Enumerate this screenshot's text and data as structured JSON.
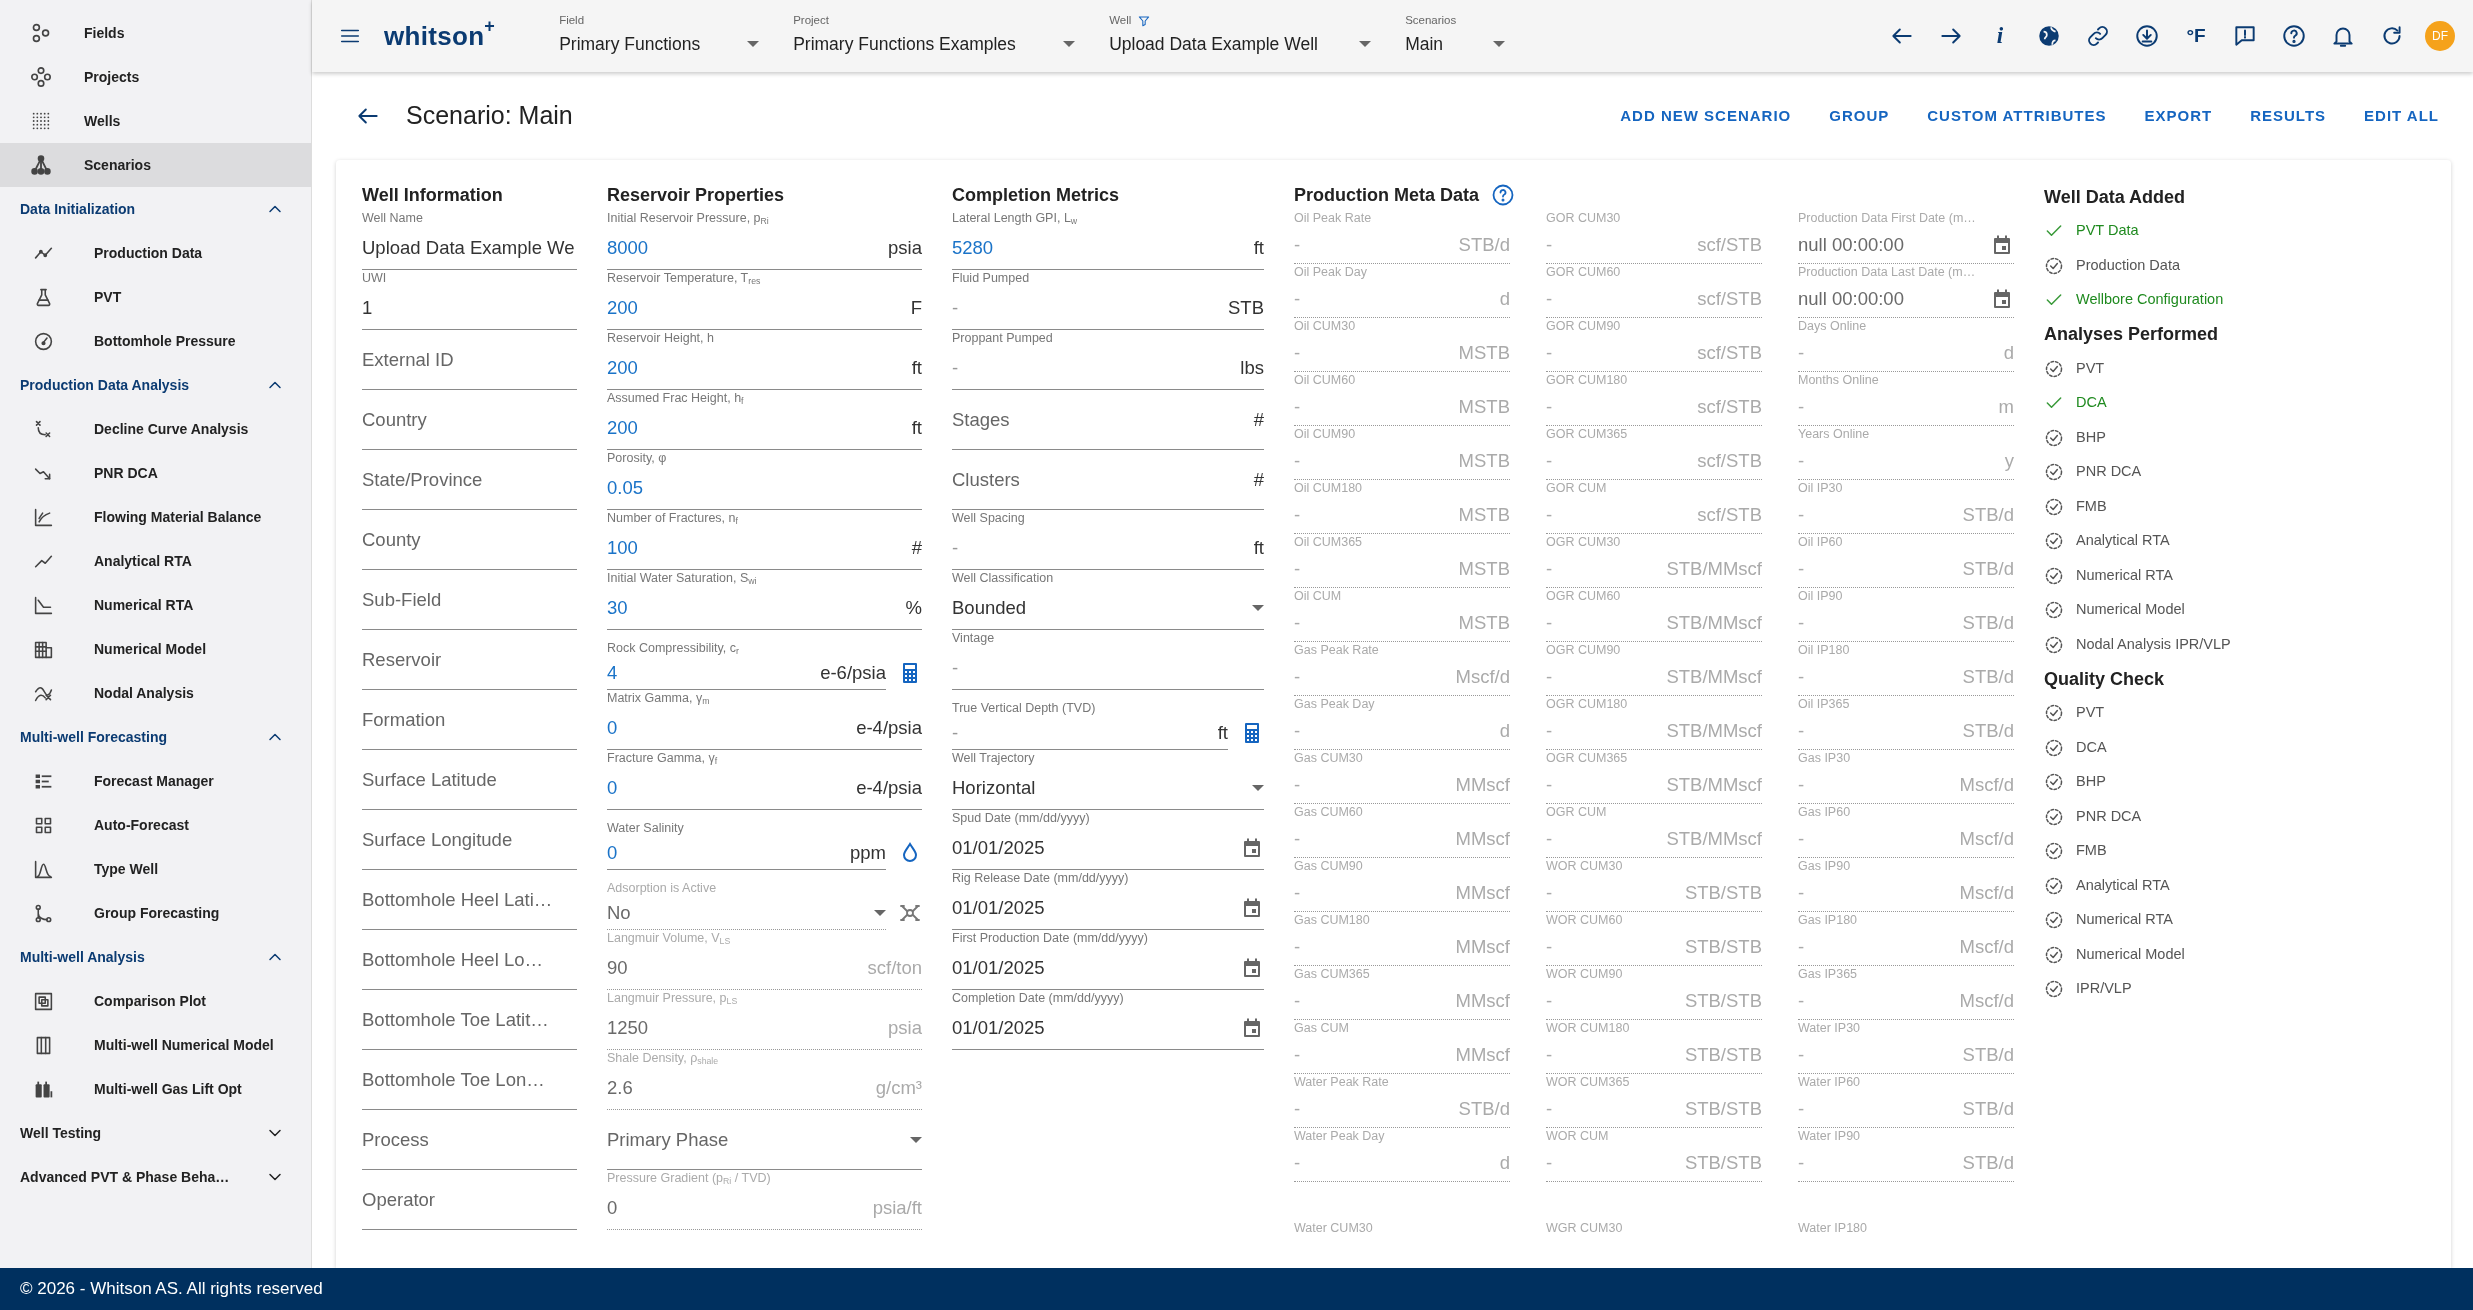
{
  "sidebar": {
    "items": [
      {
        "label": "Fields",
        "selected": false
      },
      {
        "label": "Projects",
        "selected": false
      },
      {
        "label": "Wells",
        "selected": false
      },
      {
        "label": "Scenarios",
        "selected": true
      }
    ],
    "sections": [
      {
        "title": "Data Initialization",
        "expanded": true,
        "items": [
          {
            "label": "Production Data",
            "selected": false
          },
          {
            "label": "PVT",
            "selected": false
          },
          {
            "label": "Bottomhole Pressure",
            "selected": false
          }
        ]
      },
      {
        "title": "Production Data Analysis",
        "expanded": true,
        "items": [
          {
            "label": "Decline Curve Analysis",
            "selected": false
          },
          {
            "label": "PNR DCA",
            "selected": false
          },
          {
            "label": "Flowing Material Balance",
            "selected": false
          },
          {
            "label": "Analytical RTA",
            "selected": false
          },
          {
            "label": "Numerical RTA",
            "selected": false
          },
          {
            "label": "Numerical Model",
            "selected": false
          },
          {
            "label": "Nodal Analysis",
            "selected": false
          }
        ]
      },
      {
        "title": "Multi-well Forecasting",
        "expanded": true,
        "items": [
          {
            "label": "Forecast Manager",
            "selected": false
          },
          {
            "label": "Auto-Forecast",
            "selected": false
          },
          {
            "label": "Type Well",
            "selected": false
          },
          {
            "label": "Group Forecasting",
            "selected": false
          }
        ]
      },
      {
        "title": "Multi-well Analysis",
        "expanded": true,
        "items": [
          {
            "label": "Comparison Plot",
            "selected": false
          },
          {
            "label": "Multi-well Numerical Model",
            "selected": false
          },
          {
            "label": "Multi-well Gas Lift Opt",
            "selected": false
          }
        ]
      },
      {
        "title": "Well Testing",
        "expanded": false
      },
      {
        "title": "Advanced PVT & Phase Beha…",
        "expanded": false
      }
    ]
  },
  "app_bar": {
    "logo": "whitson$^{+}$",
    "selectors": [
      {
        "label": "Field",
        "value": "Primary Functions"
      },
      {
        "label": "Project",
        "value": "Primary Functions Examples"
      },
      {
        "label": "Well",
        "value": "Upload Data Example Well"
      },
      {
        "label": "Scenarios",
        "value": "Main"
      }
    ],
    "info_glyph": "i",
    "units": "°F",
    "avatar": "DF"
  },
  "page": {
    "title": "Scenario: Main",
    "actions": [
      "ADD NEW SCENARIO",
      "GROUP",
      "CUSTOM ATTRIBUTES",
      "EXPORT",
      "RESULTS",
      "EDIT ALL"
    ]
  },
  "well_information": {
    "title": "Well Information",
    "fields": [
      {
        "label": "Well Name",
        "value": "Upload Data Example We",
        "kind": "text",
        "disabled": false
      },
      {
        "label": "UWI",
        "value": "1",
        "kind": "text",
        "disabled": false
      },
      {
        "placeholder": "External ID",
        "kind": "text",
        "disabled": false
      },
      {
        "placeholder": "Country",
        "kind": "text",
        "disabled": false
      },
      {
        "placeholder": "State/Province",
        "kind": "text",
        "disabled": false
      },
      {
        "placeholder": "County",
        "kind": "text",
        "disabled": false
      },
      {
        "placeholder": "Sub-Field",
        "kind": "text",
        "disabled": false
      },
      {
        "placeholder": "Reservoir",
        "kind": "text",
        "disabled": false
      },
      {
        "placeholder": "Formation",
        "kind": "text",
        "disabled": false
      },
      {
        "placeholder": "Surface Latitude",
        "kind": "text",
        "disabled": false
      },
      {
        "placeholder": "Surface Longitude",
        "kind": "text",
        "disabled": false
      },
      {
        "placeholder": "Bottomhole Heel Lati…",
        "kind": "text",
        "disabled": false
      },
      {
        "placeholder": "Bottomhole Heel Lo…",
        "kind": "text",
        "disabled": false
      },
      {
        "placeholder": "Bottomhole Toe Latit…",
        "kind": "text",
        "disabled": false
      },
      {
        "placeholder": "Bottomhole Toe Lon…",
        "kind": "text",
        "disabled": false
      },
      {
        "placeholder": "Process",
        "kind": "text",
        "disabled": false
      },
      {
        "placeholder": "Operator",
        "kind": "text",
        "disabled": false
      }
    ]
  },
  "reservoir_properties": {
    "title": "Reservoir Properties",
    "fields": [
      {
        "label": "Initial Reservoir Pressure, p$_{Ri}$",
        "value": "8000",
        "unit": "psia",
        "kind": "number",
        "disabled": false
      },
      {
        "label": "Reservoir Temperature, T$_{res}$",
        "value": "200",
        "unit": "F",
        "kind": "number",
        "disabled": false
      },
      {
        "label": "Reservoir Height, h",
        "value": "200",
        "unit": "ft",
        "kind": "number",
        "disabled": false
      },
      {
        "label": "Assumed Frac Height, h$_{f}$",
        "value": "200",
        "unit": "ft",
        "kind": "number",
        "disabled": false
      },
      {
        "label": "Porosity, φ",
        "value": "0.05",
        "kind": "number",
        "disabled": false
      },
      {
        "label": "Number of Fractures, n$_{f}$",
        "value": "100",
        "unit": "#",
        "kind": "number",
        "disabled": false
      },
      {
        "label": "Initial Water Saturation, S$_{wi}$",
        "value": "30",
        "unit": "%",
        "kind": "number",
        "disabled": false
      },
      {
        "label": "Rock Compressibility, c$_{r}$",
        "value": "4",
        "unit": "e-6/psia",
        "kind": "number",
        "disabled": false,
        "side_button": {
          "kind": "calculator"
        }
      },
      {
        "label": "Matrix Gamma, γ$_{m}$",
        "value": "0",
        "unit": "e-4/psia",
        "kind": "number",
        "disabled": false
      },
      {
        "label": "Fracture Gamma, γ$_{f}$",
        "value": "0",
        "unit": "e-4/psia",
        "kind": "number",
        "disabled": false
      },
      {
        "label": "Water Salinity",
        "value": "0",
        "unit": "ppm",
        "kind": "number",
        "disabled": false,
        "side_button": {
          "kind": "salinity"
        }
      },
      {
        "label": "Adsorption is Active",
        "value": "No",
        "kind": "select",
        "disabled": true,
        "side_button": {
          "kind": "adsorption"
        }
      },
      {
        "label": "Langmuir Volume, V$_{LS}$",
        "value": "90",
        "unit": "scf/ton",
        "kind": "text",
        "disabled": true
      },
      {
        "label": "Langmuir Pressure, p$_{LS}$",
        "value": "1250",
        "unit": "psia",
        "kind": "text",
        "disabled": true
      },
      {
        "label": "Shale Density, ρ$_{shale}$",
        "value": "2.6",
        "unit": "g/cm³",
        "kind": "text",
        "disabled": true
      },
      {
        "placeholder": "Primary Phase",
        "kind": "select",
        "disabled": false
      },
      {
        "label": "Pressure Gradient (p$_{Ri}$ / TVD)",
        "value": "0",
        "unit": "psia/ft",
        "kind": "text",
        "disabled": true
      }
    ]
  },
  "completion_metrics": {
    "title": "Completion Metrics",
    "fields": [
      {
        "label": "Lateral Length GPI, L$_{w}$",
        "value": "5280",
        "unit": "ft",
        "kind": "number",
        "disabled": false
      },
      {
        "label": "Fluid Pumped",
        "value": "-",
        "unit": "STB",
        "kind": "empty",
        "disabled": false
      },
      {
        "label": "Proppant Pumped",
        "value": "-",
        "unit": "lbs",
        "kind": "empty",
        "disabled": false
      },
      {
        "placeholder": "Stages",
        "unit": "#",
        "kind": "text",
        "disabled": false
      },
      {
        "placeholder": "Clusters",
        "unit": "#",
        "kind": "text",
        "disabled": false
      },
      {
        "label": "Well Spacing",
        "value": "-",
        "unit": "ft",
        "kind": "empty",
        "disabled": false
      },
      {
        "label": "Well Classification",
        "value": "Bounded",
        "kind": "select",
        "disabled": false
      },
      {
        "label": "Vintage",
        "value": "-",
        "kind": "empty",
        "disabled": false
      },
      {
        "label": "True Vertical Depth (TVD)",
        "value": "-",
        "unit": "ft",
        "kind": "empty",
        "disabled": false,
        "side_button": {
          "kind": "calculator"
        }
      },
      {
        "label": "Well Trajectory",
        "value": "Horizontal",
        "kind": "select",
        "disabled": false
      },
      {
        "label": "Spud Date (mm/dd/yyyy)",
        "value": "01/01/2025",
        "kind": "date",
        "disabled": false
      },
      {
        "label": "Rig Release Date (mm/dd/yyyy)",
        "value": "01/01/2025",
        "kind": "date",
        "disabled": false
      },
      {
        "label": "First Production Date (mm/dd/yyyy)",
        "value": "01/01/2025",
        "kind": "date",
        "disabled": false
      },
      {
        "label": "Completion Date (mm/dd/yyyy)",
        "value": "01/01/2025",
        "kind": "date",
        "disabled": false
      }
    ]
  },
  "production_meta_data": {
    "title": "Production Meta Data",
    "columns": [
      [
        {
          "label": "Oil Peak Rate",
          "value": "-",
          "unit": "STB/d",
          "kind": "empty",
          "disabled": true
        },
        {
          "label": "Oil Peak Day",
          "value": "-",
          "unit": "d",
          "kind": "empty",
          "disabled": true
        },
        {
          "label": "Oil CUM30",
          "value": "-",
          "unit": "MSTB",
          "kind": "empty",
          "disabled": true
        },
        {
          "label": "Oil CUM60",
          "value": "-",
          "unit": "MSTB",
          "kind": "empty",
          "disabled": true
        },
        {
          "label": "Oil CUM90",
          "value": "-",
          "unit": "MSTB",
          "kind": "empty",
          "disabled": true
        },
        {
          "label": "Oil CUM180",
          "value": "-",
          "unit": "MSTB",
          "kind": "empty",
          "disabled": true
        },
        {
          "label": "Oil CUM365",
          "value": "-",
          "unit": "MSTB",
          "kind": "empty",
          "disabled": true
        },
        {
          "label": "Oil CUM",
          "value": "-",
          "unit": "MSTB",
          "kind": "empty",
          "disabled": true
        },
        {
          "label": "Gas Peak Rate",
          "value": "-",
          "unit": "Mscf/d",
          "kind": "empty",
          "disabled": true
        },
        {
          "label": "Gas Peak Day",
          "value": "-",
          "unit": "d",
          "kind": "empty",
          "disabled": true
        },
        {
          "label": "Gas CUM30",
          "value": "-",
          "unit": "MMscf",
          "kind": "empty",
          "disabled": true
        },
        {
          "label": "Gas CUM60",
          "value": "-",
          "unit": "MMscf",
          "kind": "empty",
          "disabled": true
        },
        {
          "label": "Gas CUM90",
          "value": "-",
          "unit": "MMscf",
          "kind": "empty",
          "disabled": true
        },
        {
          "label": "Gas CUM180",
          "value": "-",
          "unit": "MMscf",
          "kind": "empty",
          "disabled": true
        },
        {
          "label": "Gas CUM365",
          "value": "-",
          "unit": "MMscf",
          "kind": "empty",
          "disabled": true
        },
        {
          "label": "Gas CUM",
          "value": "-",
          "unit": "MMscf",
          "kind": "empty",
          "disabled": true
        },
        {
          "label": "Water Peak Rate",
          "value": "-",
          "unit": "STB/d",
          "kind": "empty",
          "disabled": true
        },
        {
          "label": "Water Peak Day",
          "value": "-",
          "unit": "d",
          "kind": "empty",
          "disabled": true
        },
        {
          "label": "Water CUM30",
          "kind": "empty",
          "disabled": true
        }
      ],
      [
        {
          "label": "GOR CUM30",
          "value": "-",
          "unit": "scf/STB",
          "kind": "empty",
          "disabled": true
        },
        {
          "label": "GOR CUM60",
          "value": "-",
          "unit": "scf/STB",
          "kind": "empty",
          "disabled": true
        },
        {
          "label": "GOR CUM90",
          "value": "-",
          "unit": "scf/STB",
          "kind": "empty",
          "disabled": true
        },
        {
          "label": "GOR CUM180",
          "value": "-",
          "unit": "scf/STB",
          "kind": "empty",
          "disabled": true
        },
        {
          "label": "GOR CUM365",
          "value": "-",
          "unit": "scf/STB",
          "kind": "empty",
          "disabled": true
        },
        {
          "label": "GOR CUM",
          "value": "-",
          "unit": "scf/STB",
          "kind": "empty",
          "disabled": true
        },
        {
          "label": "OGR CUM30",
          "value": "-",
          "unit": "STB/MMscf",
          "kind": "empty",
          "disabled": true
        },
        {
          "label": "OGR CUM60",
          "value": "-",
          "unit": "STB/MMscf",
          "kind": "empty",
          "disabled": true
        },
        {
          "label": "OGR CUM90",
          "value": "-",
          "unit": "STB/MMscf",
          "kind": "empty",
          "disabled": true
        },
        {
          "label": "OGR CUM180",
          "value": "-",
          "unit": "STB/MMscf",
          "kind": "empty",
          "disabled": true
        },
        {
          "label": "OGR CUM365",
          "value": "-",
          "unit": "STB/MMscf",
          "kind": "empty",
          "disabled": true
        },
        {
          "label": "OGR CUM",
          "value": "-",
          "unit": "STB/MMscf",
          "kind": "empty",
          "disabled": true
        },
        {
          "label": "WOR CUM30",
          "value": "-",
          "unit": "STB/STB",
          "kind": "empty",
          "disabled": true
        },
        {
          "label": "WOR CUM60",
          "value": "-",
          "unit": "STB/STB",
          "kind": "empty",
          "disabled": true
        },
        {
          "label": "WOR CUM90",
          "value": "-",
          "unit": "STB/STB",
          "kind": "empty",
          "disabled": true
        },
        {
          "label": "WOR CUM180",
          "value": "-",
          "unit": "STB/STB",
          "kind": "empty",
          "disabled": true
        },
        {
          "label": "WOR CUM365",
          "value": "-",
          "unit": "STB/STB",
          "kind": "empty",
          "disabled": true
        },
        {
          "label": "WOR CUM",
          "value": "-",
          "unit": "STB/STB",
          "kind": "empty",
          "disabled": true
        },
        {
          "label": "WGR CUM30",
          "kind": "empty",
          "disabled": true
        }
      ],
      [
        {
          "label": "Production Data First Date (m…",
          "value": "null 00:00:00",
          "kind": "date",
          "disabled": true
        },
        {
          "label": "Production Data Last Date (m…",
          "value": "null 00:00:00",
          "kind": "date",
          "disabled": true
        },
        {
          "label": "Days Online",
          "value": "-",
          "unit": "d",
          "kind": "empty",
          "disabled": true
        },
        {
          "label": "Months Online",
          "value": "-",
          "unit": "m",
          "kind": "empty",
          "disabled": true
        },
        {
          "label": "Years Online",
          "value": "-",
          "unit": "y",
          "kind": "empty",
          "disabled": true
        },
        {
          "label": "Oil IP30",
          "value": "-",
          "unit": "STB/d",
          "kind": "empty",
          "disabled": true
        },
        {
          "label": "Oil IP60",
          "value": "-",
          "unit": "STB/d",
          "kind": "empty",
          "disabled": true
        },
        {
          "label": "Oil IP90",
          "value": "-",
          "unit": "STB/d",
          "kind": "empty",
          "disabled": true
        },
        {
          "label": "Oil IP180",
          "value": "-",
          "unit": "STB/d",
          "kind": "empty",
          "disabled": true
        },
        {
          "label": "Oil IP365",
          "value": "-",
          "unit": "STB/d",
          "kind": "empty",
          "disabled": true
        },
        {
          "label": "Gas IP30",
          "value": "-",
          "unit": "Mscf/d",
          "kind": "empty",
          "disabled": true
        },
        {
          "label": "Gas IP60",
          "value": "-",
          "unit": "Mscf/d",
          "kind": "empty",
          "disabled": true
        },
        {
          "label": "Gas IP90",
          "value": "-",
          "unit": "Mscf/d",
          "kind": "empty",
          "disabled": true
        },
        {
          "label": "Gas IP180",
          "value": "-",
          "unit": "Mscf/d",
          "kind": "empty",
          "disabled": true
        },
        {
          "label": "Gas IP365",
          "value": "-",
          "unit": "Mscf/d",
          "kind": "empty",
          "disabled": true
        },
        {
          "label": "Water IP30",
          "value": "-",
          "unit": "STB/d",
          "kind": "empty",
          "disabled": true
        },
        {
          "label": "Water IP60",
          "value": "-",
          "unit": "STB/d",
          "kind": "empty",
          "disabled": true
        },
        {
          "label": "Water IP90",
          "value": "-",
          "unit": "STB/d",
          "kind": "empty",
          "disabled": true
        },
        {
          "label": "Water IP180",
          "kind": "empty",
          "disabled": true
        }
      ]
    ]
  },
  "status_sections": [
    {
      "title": "Well Data Added",
      "items": [
        {
          "label": "PVT Data",
          "done": true
        },
        {
          "label": "Production Data",
          "done": false
        },
        {
          "label": "Wellbore Configuration",
          "done": true
        }
      ]
    },
    {
      "title": "Analyses Performed",
      "items": [
        {
          "label": "PVT",
          "done": false
        },
        {
          "label": "DCA",
          "done": true
        },
        {
          "label": "BHP",
          "done": false
        },
        {
          "label": "PNR DCA",
          "done": false
        },
        {
          "label": "FMB",
          "done": false
        },
        {
          "label": "Analytical RTA",
          "done": false
        },
        {
          "label": "Numerical RTA",
          "done": false
        },
        {
          "label": "Numerical Model",
          "done": false
        },
        {
          "label": "Nodal Analysis IPR/VLP",
          "done": false
        }
      ]
    },
    {
      "title": "Quality Check",
      "items": [
        {
          "label": "PVT",
          "done": false
        },
        {
          "label": "DCA",
          "done": false
        },
        {
          "label": "BHP",
          "done": false
        },
        {
          "label": "PNR DCA",
          "done": false
        },
        {
          "label": "FMB",
          "done": false
        },
        {
          "label": "Analytical RTA",
          "done": false
        },
        {
          "label": "Numerical RTA",
          "done": false
        },
        {
          "label": "Numerical Model",
          "done": false
        },
        {
          "label": "IPR/VLP",
          "done": false
        }
      ]
    }
  ],
  "footer": {
    "text": "© 2026 - Whitson AS. All rights reserved"
  }
}
